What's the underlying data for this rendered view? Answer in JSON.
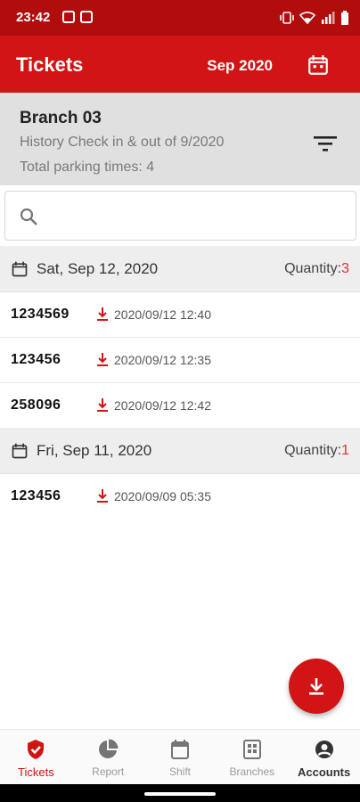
{
  "status_bar": {
    "time": "23:42",
    "icons": [
      "instagram-icon",
      "image-icon",
      "vibrate-icon",
      "wifi-icon",
      "signal-icon",
      "battery-icon"
    ]
  },
  "app_bar": {
    "title": "Tickets",
    "month": "Sep 2020",
    "calendar_icon": "calendar-icon"
  },
  "branch": {
    "name": "Branch 03",
    "subtitle": "History Check in & out of 9/2020",
    "total": "Total parking times: 4"
  },
  "search": {
    "placeholder": "",
    "value": ""
  },
  "groups": [
    {
      "date": "Sat, Sep 12, 2020",
      "quantity_label": "Quantity:",
      "quantity": "3",
      "tickets": [
        {
          "number": "1234569",
          "time": "2020/09/12 12:40"
        },
        {
          "number": "123456",
          "time": "2020/09/12 12:35"
        },
        {
          "number": "258096",
          "time": "2020/09/12 12:42"
        }
      ]
    },
    {
      "date": "Fri, Sep 11, 2020",
      "quantity_label": "Quantity:",
      "quantity": "1",
      "tickets": [
        {
          "number": "123456",
          "time": "2020/09/09 05:35"
        }
      ]
    }
  ],
  "bottom_nav": [
    {
      "label": "Tickets",
      "icon": "shield-check-icon",
      "active": true
    },
    {
      "label": "Report",
      "icon": "pie-chart-icon",
      "active": false
    },
    {
      "label": "Shift",
      "icon": "calendar-icon",
      "active": false
    },
    {
      "label": "Branches",
      "icon": "branches-icon",
      "active": false
    },
    {
      "label": "Accounts",
      "icon": "account-icon",
      "active": false
    }
  ],
  "colors": {
    "primary": "#d11414",
    "status_bar": "#b10d0d",
    "quantity": "#e03131"
  }
}
